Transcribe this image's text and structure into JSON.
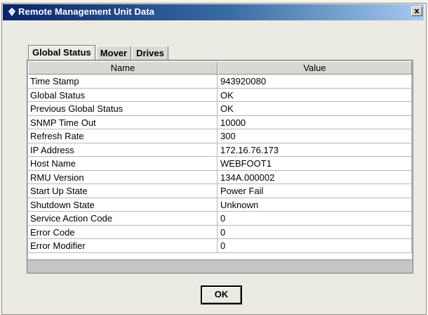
{
  "window": {
    "title": "Remote Management Unit Data",
    "close_glyph": "x",
    "title_icon": "java-coffee-icon"
  },
  "tabs": [
    {
      "label": "Global Status",
      "active": true
    },
    {
      "label": "Mover",
      "active": false
    },
    {
      "label": "Drives",
      "active": false
    }
  ],
  "table": {
    "columns": [
      "Name",
      "Value"
    ],
    "rows": [
      {
        "name": "Time Stamp",
        "value": "943920080"
      },
      {
        "name": "Global Status",
        "value": "OK"
      },
      {
        "name": "Previous Global Status",
        "value": "OK"
      },
      {
        "name": "SNMP Time Out",
        "value": "10000"
      },
      {
        "name": "Refresh Rate",
        "value": "300"
      },
      {
        "name": "IP Address",
        "value": "172.16.76.173"
      },
      {
        "name": "Host Name",
        "value": "WEBFOOT1"
      },
      {
        "name": "RMU Version",
        "value": "134A.000002"
      },
      {
        "name": "Start Up State",
        "value": "Power Fail"
      },
      {
        "name": "Shutdown State",
        "value": "Unknown"
      },
      {
        "name": "Service Action Code",
        "value": "0"
      },
      {
        "name": "Error Code",
        "value": "0"
      },
      {
        "name": "Error Modifier",
        "value": "0"
      }
    ]
  },
  "buttons": {
    "ok_label": "OK"
  }
}
